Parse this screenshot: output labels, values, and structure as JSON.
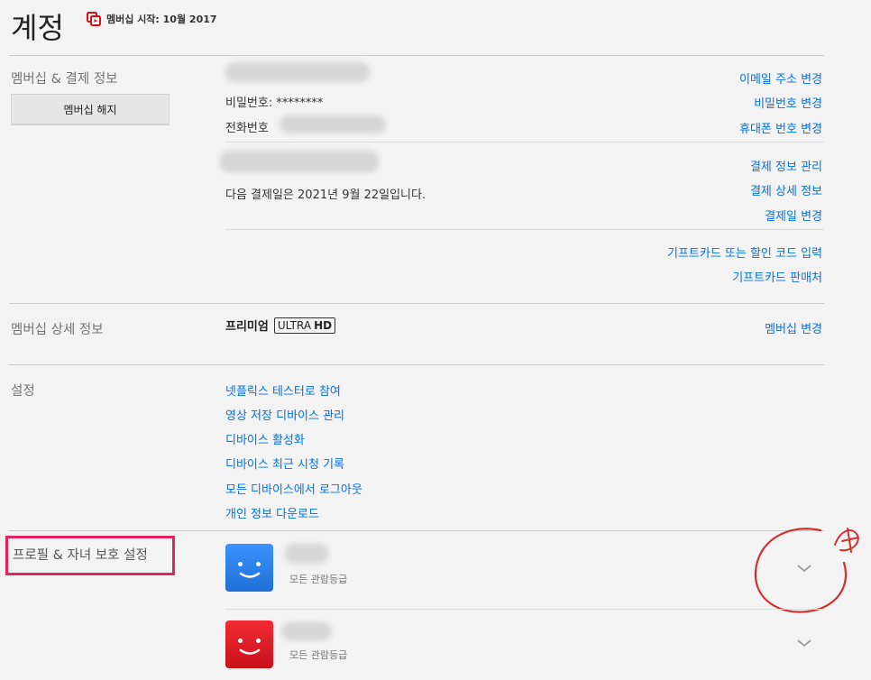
{
  "header": {
    "title": "계정",
    "member_since": "멤버십 시작: 10월 2017"
  },
  "membership_billing": {
    "label": "멤버십 & 결제 정보",
    "cancel_button": "멤버십 해지",
    "password": "비밀번호: ********",
    "phone_label": "전화번호",
    "next_billing": "다음 결제일은 2021년 9월 22일입니다.",
    "links": {
      "change_email": "이메일 주소 변경",
      "change_password": "비밀번호 변경",
      "change_phone": "휴대폰 번호 변경",
      "manage_payment": "결제 정보 관리",
      "billing_details": "결제 상세 정보",
      "change_billing_date": "결제일 변경",
      "redeem_gift": "기프트카드 또는 할인 코드 입력",
      "gift_retailers": "기프트카드 판매처"
    }
  },
  "plan": {
    "label": "멤버십 상세 정보",
    "plan_name": "프리미엄",
    "badge_ultra": "ULTRA",
    "badge_hd": "HD",
    "change_plan": "멤버십 변경"
  },
  "settings": {
    "label": "설정",
    "items": [
      "넷플릭스 테스터로 참여",
      "영상 저장 디바이스 관리",
      "디바이스 활성화",
      "디바이스 최근 시청 기록",
      "모든 디바이스에서 로그아웃",
      "개인 정보 다운로드"
    ]
  },
  "profiles": {
    "label": "프로필 & 자녀 보호 설정",
    "items": [
      {
        "rating": "모든 관람등급",
        "color": "#2f86f2"
      },
      {
        "rating": "모든 관람등급",
        "color": "#e8212b"
      }
    ]
  },
  "colors": {
    "link": "#0073e6",
    "highlight_box": "#e0245e",
    "annotation": "#d0312d"
  }
}
